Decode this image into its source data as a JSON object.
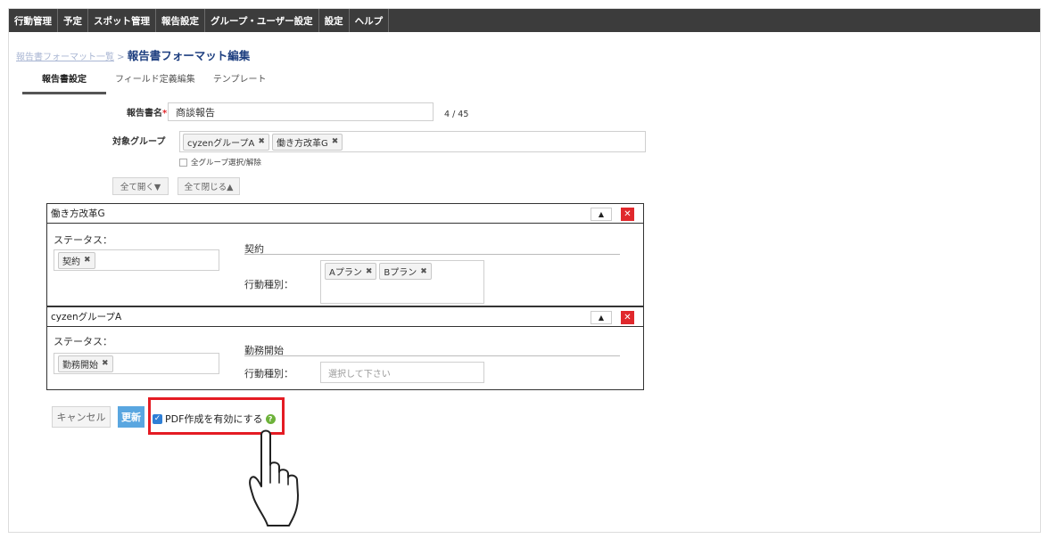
{
  "nav": {
    "items": [
      "行動管理",
      "予定",
      "スポット管理",
      "報告設定",
      "グループ・ユーザー設定",
      "設定",
      "ヘルプ"
    ]
  },
  "breadcrumb": {
    "parent": "報告書フォーマット一覧",
    "separator": " > ",
    "current": "報告書フォーマット編集"
  },
  "tabs": [
    "報告書設定",
    "フィールド定義編集",
    "テンプレート"
  ],
  "form": {
    "report_name_label": "報告書名",
    "required_mark": "*",
    "report_name_value": "商談報告",
    "char_counter": "4 / 45",
    "group_label": "対象グループ",
    "groups": [
      "cyzenグループA",
      "働き方改革G"
    ],
    "select_all_label": "全グループ選択/解除",
    "expand_all": "全て開く▼",
    "collapse_all": "全て閉じる▲"
  },
  "sections": [
    {
      "title": "働き方改革G",
      "status_label": "ステータス：",
      "status_tags": [
        "契約"
      ],
      "status_heading": "契約",
      "action_label": "行動種別：",
      "action_tags": [
        "Aプラン",
        "Bプラン"
      ],
      "action_placeholder": ""
    },
    {
      "title": "cyzenグループA",
      "status_label": "ステータス：",
      "status_tags": [
        "勤務開始"
      ],
      "status_heading": "勤務開始",
      "action_label": "行動種別：",
      "action_tags": [],
      "action_placeholder": "選択して下さい"
    }
  ],
  "section_buttons": {
    "move_up": "▲",
    "remove": "✕"
  },
  "tag_remove": "✖",
  "actions": {
    "cancel": "キャンセル",
    "update": "更新",
    "pdf_checkbox_label": "PDF作成を有効にする",
    "pdf_checked": true,
    "help": "?"
  },
  "colors": {
    "nav_bg": "#3c3c3c",
    "accent_blue": "#59a6e0",
    "breadcrumb_current": "#1e3f80",
    "highlight_red": "#e41b23",
    "delete_red": "#e0282c",
    "help_green": "#6db23a"
  }
}
